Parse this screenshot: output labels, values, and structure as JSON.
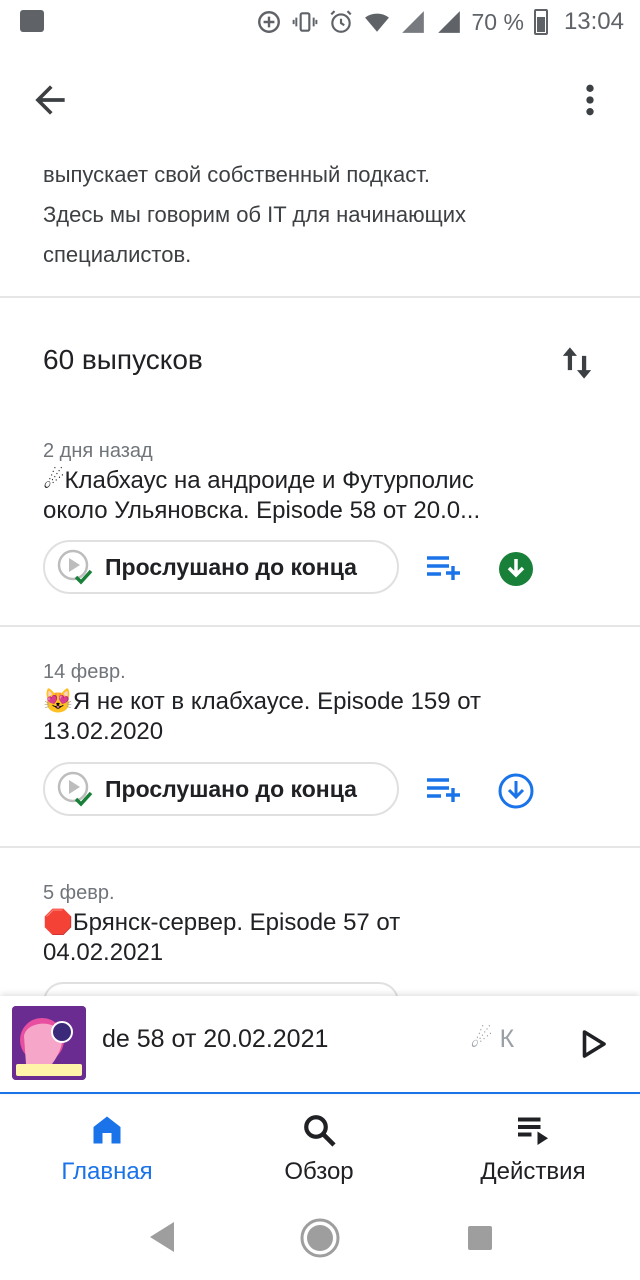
{
  "status_bar": {
    "battery": "70 %",
    "time": "13:04"
  },
  "app_bar": {
    "back_icon": "arrow-back-icon",
    "more_icon": "more-vert-icon"
  },
  "description": {
    "lines": [
      "выпускает свой собственный подкаст.",
      "Здесь мы говорим об IT для начинающих",
      "специалистов."
    ]
  },
  "episodes_header": {
    "count_label": "60 выпусков",
    "sort_icon": "sort-icon"
  },
  "episodes": [
    {
      "date": "2 дня назад",
      "emoji": "☄",
      "title_line1": "Клабхаус на андроиде и Футурполис",
      "title_line2": "около Ульяновска. Episode 58 от 20.0...",
      "played_label": "Прослушано до конца",
      "downloaded": true
    },
    {
      "date": "14 февр.",
      "emoji": "😻",
      "title_line1": "Я не кот в клабхаусе. Episode 159 от",
      "title_line2": "13.02.2020",
      "played_label": "Прослушано до конца",
      "downloaded": false
    },
    {
      "date": "5 февр.",
      "emoji": "🛑",
      "title_line1": "Брянск-сервер. Episode 57 от",
      "title_line2": "04.02.2021",
      "played_label": "",
      "downloaded": false
    }
  ],
  "mini_player": {
    "text": "de 58 от 20.02.2021",
    "tail": "☄ К",
    "art_label": "ITWay podcast"
  },
  "bottom_nav": [
    {
      "label": "Главная",
      "icon": "home-icon",
      "active": true
    },
    {
      "label": "Обзор",
      "icon": "search-icon",
      "active": false
    },
    {
      "label": "Действия",
      "icon": "activity-icon",
      "active": false
    }
  ],
  "colors": {
    "accent": "#1a73e8",
    "download_green": "#188038"
  }
}
